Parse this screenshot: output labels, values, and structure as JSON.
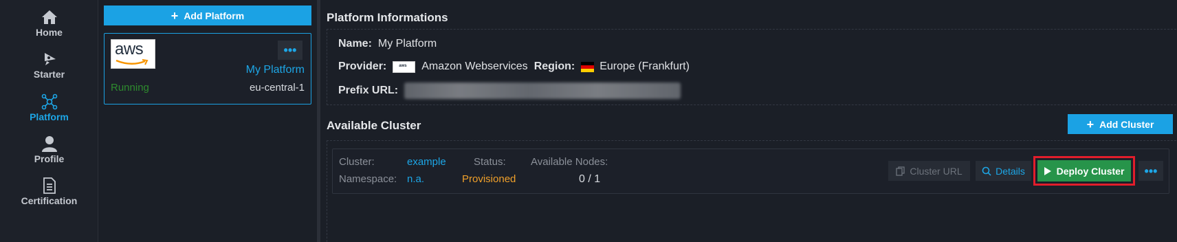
{
  "nav": {
    "items": [
      {
        "label": "Home",
        "icon": "home-icon"
      },
      {
        "label": "Starter",
        "icon": "rocket-icon"
      },
      {
        "label": "Platform",
        "icon": "network-icon"
      },
      {
        "label": "Profile",
        "icon": "user-icon"
      },
      {
        "label": "Certification",
        "icon": "document-icon"
      }
    ],
    "active": "Platform"
  },
  "platform_list": {
    "add_label": "Add Platform",
    "cards": [
      {
        "logo_text": "aws",
        "more": "•••",
        "name": "My Platform",
        "status": "Running",
        "region": "eu-central-1"
      }
    ]
  },
  "info": {
    "title": "Platform Informations",
    "name_label": "Name:",
    "name_value": "My Platform",
    "provider_label": "Provider:",
    "provider_value": "Amazon Webservices",
    "provider_logo": "aws",
    "region_label": "Region:",
    "region_value": "Europe (Frankfurt)",
    "prefix_label": "Prefix URL:"
  },
  "clusters": {
    "title": "Available Cluster",
    "add_label": "Add Cluster",
    "items": [
      {
        "cluster_label": "Cluster:",
        "cluster_value": "example",
        "namespace_label": "Namespace:",
        "namespace_value": "n.a.",
        "status_label": "Status:",
        "status_value": "Provisioned",
        "nodes_label": "Available Nodes:",
        "nodes_value": "0 / 1",
        "url_button": "Cluster URL",
        "details_button": "Details",
        "deploy_button": "Deploy Cluster",
        "more": "•••"
      }
    ]
  },
  "colors": {
    "accent": "#1ba2e4",
    "deploy": "#27944a",
    "highlight": "#e21d2b",
    "running": "#2e8b2e",
    "provisioned": "#f0a02a"
  }
}
